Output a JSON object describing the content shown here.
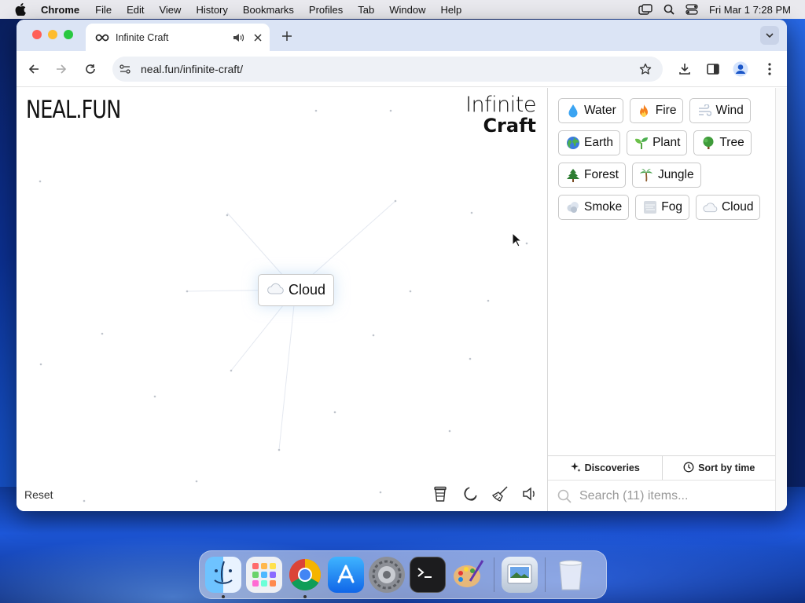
{
  "menubar": {
    "app_name": "Chrome",
    "menus": [
      "File",
      "Edit",
      "View",
      "History",
      "Bookmarks",
      "Profiles",
      "Tab",
      "Window",
      "Help"
    ],
    "clock": "Fri Mar 1  7:28 PM"
  },
  "browser": {
    "tab_title": "Infinite Craft",
    "url": "neal.fun/infinite-craft/"
  },
  "page": {
    "logo_left": "NEAL.FUN",
    "logo_right_line1": "Infinite",
    "logo_right_line2": "Craft",
    "crafted_element": {
      "emoji": "cloud",
      "label": "Cloud"
    },
    "reset_label": "Reset"
  },
  "sidebar": {
    "items": [
      {
        "label": "Water",
        "icon": "water-drop-icon"
      },
      {
        "label": "Fire",
        "icon": "fire-icon"
      },
      {
        "label": "Wind",
        "icon": "wind-icon"
      },
      {
        "label": "Earth",
        "icon": "earth-globe-icon"
      },
      {
        "label": "Plant",
        "icon": "seedling-icon"
      },
      {
        "label": "Tree",
        "icon": "tree-icon"
      },
      {
        "label": "Forest",
        "icon": "evergreen-tree-icon"
      },
      {
        "label": "Jungle",
        "icon": "palm-tree-icon"
      },
      {
        "label": "Smoke",
        "icon": "smoke-icon"
      },
      {
        "label": "Fog",
        "icon": "fog-icon"
      },
      {
        "label": "Cloud",
        "icon": "cloud-icon"
      }
    ],
    "discoveries_label": "Discoveries",
    "sort_label": "Sort by time",
    "search_placeholder": "Search (11) items..."
  },
  "dock": {
    "apps": [
      "Finder",
      "Launchpad",
      "Google Chrome",
      "App Store",
      "System Settings",
      "Terminal",
      "Paintbrush",
      "Preview",
      "Trash"
    ]
  },
  "colors": {
    "accent_blue": "#1a73e8",
    "tabstrip": "#dbe4f5",
    "traffic_red": "#ff5f57",
    "traffic_yellow": "#febc2e",
    "traffic_green": "#28c840"
  }
}
